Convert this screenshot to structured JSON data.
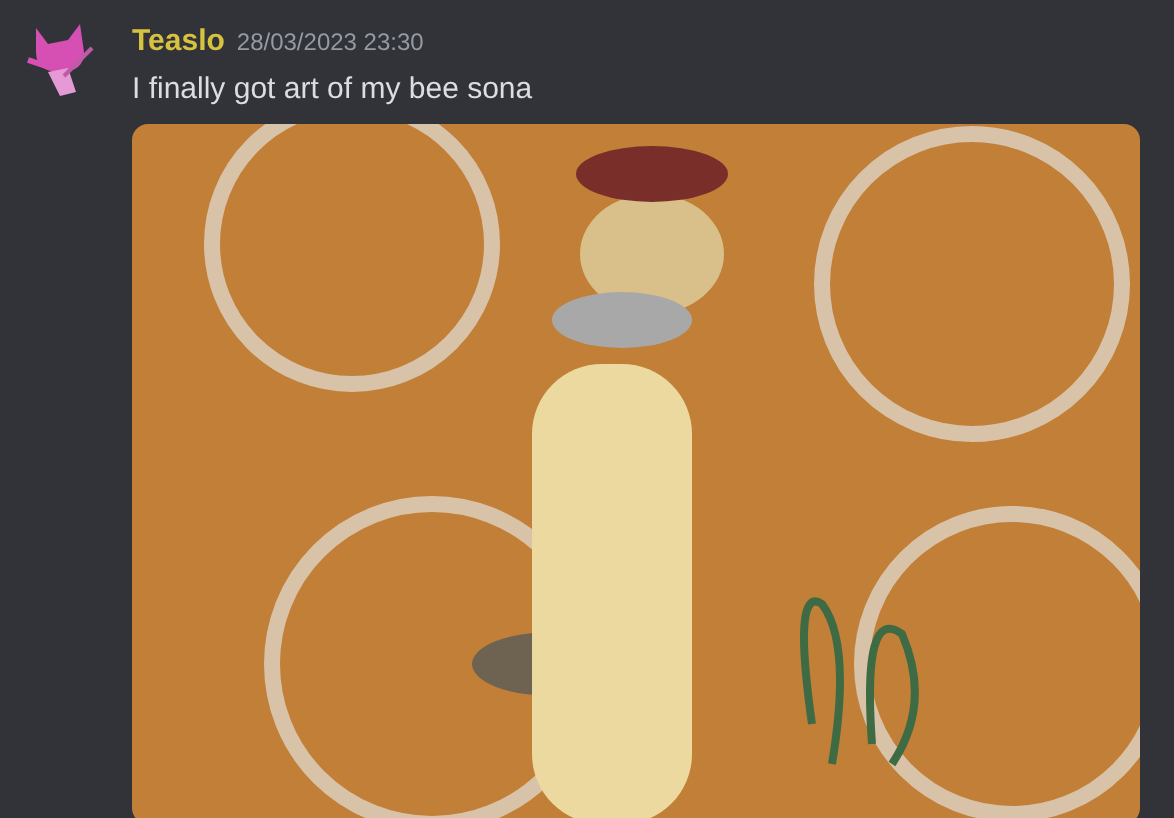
{
  "message": {
    "author": "Teaslo",
    "timestamp": "28/03/2023 23:30",
    "content": "I finally got art of my bee sona"
  }
}
